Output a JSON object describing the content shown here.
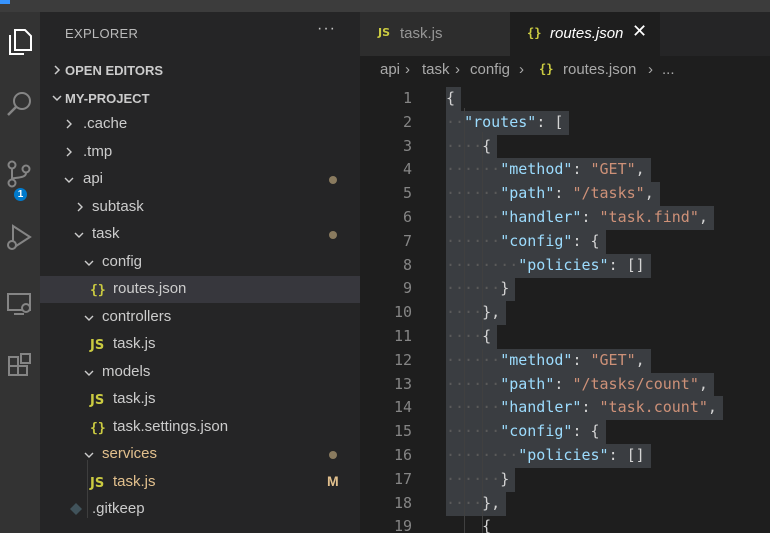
{
  "sidebar": {
    "title": "EXPLORER",
    "more": "···",
    "open_editors": "OPEN EDITORS",
    "project": "MY-PROJECT",
    "tree": [
      {
        "name": ".cache",
        "type": "folder",
        "expanded": false
      },
      {
        "name": ".tmp",
        "type": "folder",
        "expanded": false
      },
      {
        "name": "api",
        "type": "folder",
        "expanded": true
      },
      {
        "name": "subtask",
        "type": "folder",
        "expanded": false
      },
      {
        "name": "task",
        "type": "folder",
        "expanded": true
      },
      {
        "name": "config",
        "type": "folder",
        "expanded": true
      },
      {
        "name": "routes.json",
        "type": "json"
      },
      {
        "name": "controllers",
        "type": "folder",
        "expanded": true
      },
      {
        "name": "task.js",
        "type": "js"
      },
      {
        "name": "models",
        "type": "folder",
        "expanded": true
      },
      {
        "name": "task.js",
        "type": "js"
      },
      {
        "name": "task.settings.json",
        "type": "json"
      },
      {
        "name": "services",
        "type": "folder",
        "expanded": true
      },
      {
        "name": "task.js",
        "type": "js",
        "status": "M"
      },
      {
        "name": ".gitkeep",
        "type": "git"
      }
    ]
  },
  "activity": {
    "scm_badge": "1"
  },
  "tabs": [
    {
      "label": "task.js",
      "icon": "JS"
    },
    {
      "label": "routes.json",
      "icon": "{}",
      "close": "✕"
    }
  ],
  "breadcrumb": [
    "api",
    "task",
    "config",
    "routes.json",
    "..."
  ],
  "editor": {
    "line_numbers": [
      "1",
      "2",
      "3",
      "4",
      "5",
      "6",
      "7",
      "8",
      "9",
      "10",
      "11",
      "12",
      "13",
      "14",
      "15",
      "16",
      "17",
      "18",
      "19"
    ]
  },
  "colors": {
    "accent": "#007acc",
    "modified": "#e2c08d",
    "selection": "#3a3d41"
  }
}
